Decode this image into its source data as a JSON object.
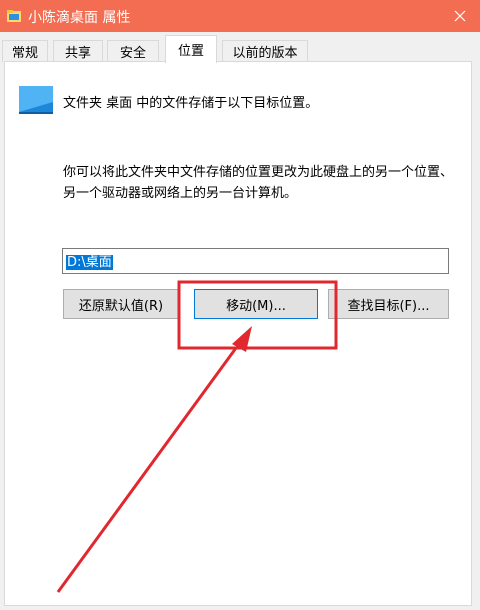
{
  "window": {
    "title": "小陈滴桌面 属性",
    "titlebar_color": "#f36d52"
  },
  "tabs": [
    {
      "label": "常规"
    },
    {
      "label": "共享"
    },
    {
      "label": "安全"
    },
    {
      "label": "位置",
      "active": true
    },
    {
      "label": "以前的版本"
    }
  ],
  "location": {
    "info": "文件夹 桌面 中的文件存储于以下目标位置。",
    "description": "你可以将此文件夹中文件存储的位置更改为此硬盘上的另一个位置、另一个驱动器或网络上的另一台计算机。",
    "path_value": "D:\\桌面"
  },
  "buttons": {
    "restore_default": "还原默认值(R)",
    "move": "移动(M)...",
    "find_target": "查找目标(F)..."
  },
  "annotation": {
    "highlight_color": "#e0282e",
    "highlights": "move-button"
  },
  "icons": {
    "title_icon": "folder-icon",
    "close": "close-icon",
    "folder": "desktop-folder-icon"
  }
}
